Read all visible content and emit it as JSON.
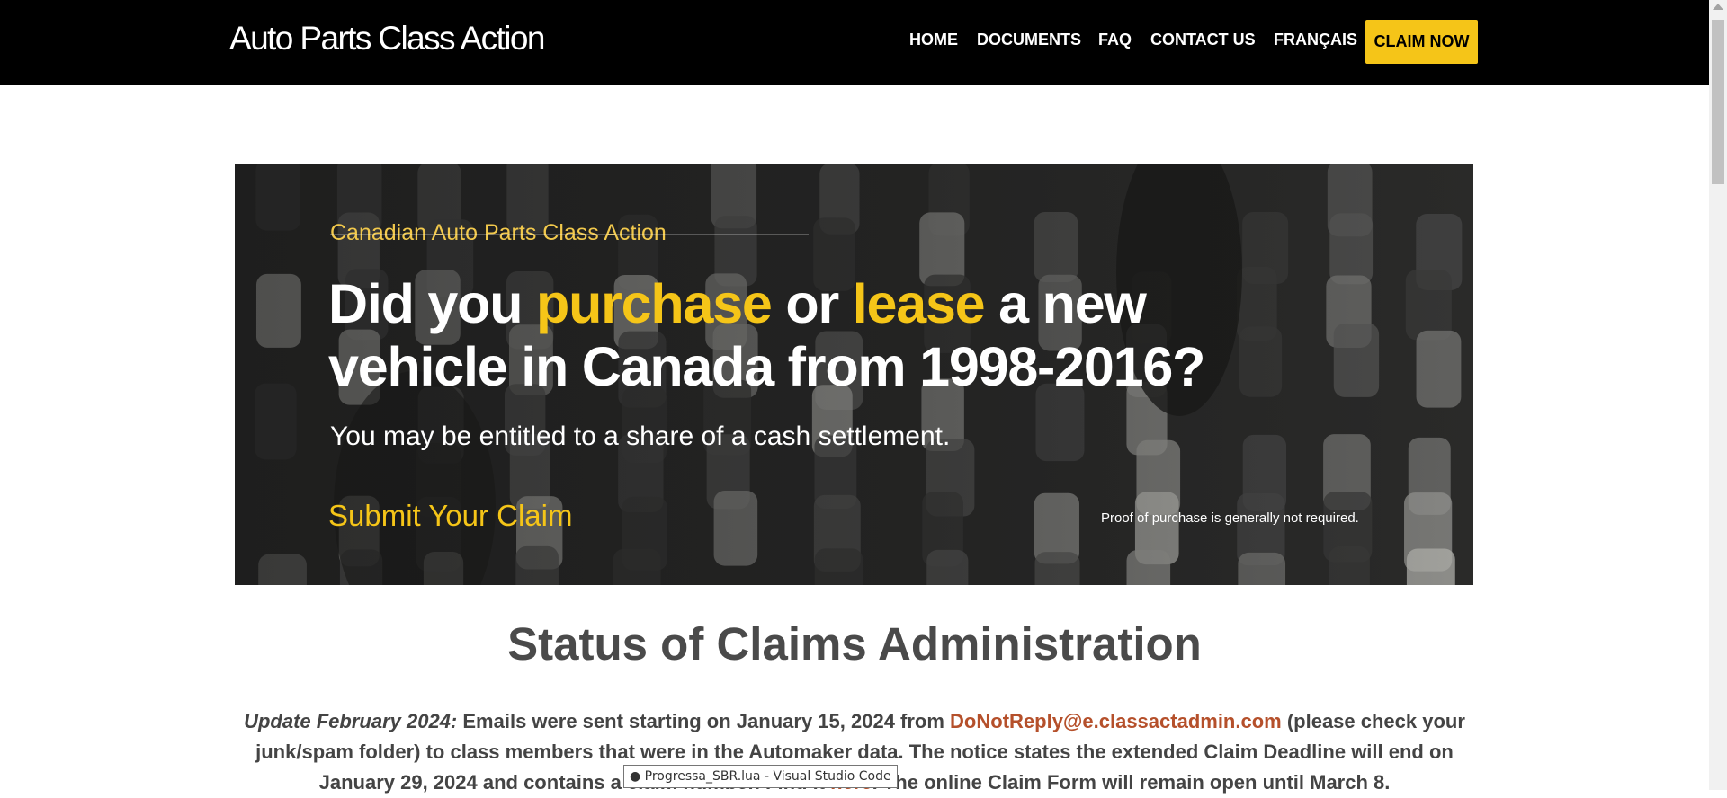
{
  "header": {
    "site_title": "Auto Parts Class Action",
    "nav": [
      "HOME",
      "DOCUMENTS",
      "FAQ",
      "CONTACT US",
      "FRANÇAIS"
    ],
    "claim_button": "CLAIM NOW"
  },
  "banner": {
    "subtitle": "Canadian Auto Parts Class Action",
    "headline": {
      "part1": "Did you ",
      "highlight1": "purchase",
      "part2": " or ",
      "highlight2": "lease",
      "part3": " a new",
      "line2": "vehicle in Canada from 1998-2016?"
    },
    "subtext": "You may be entitled to a share of a cash settlement.",
    "submit_link": "Submit Your Claim",
    "proof_note": "Proof of purchase is generally not required."
  },
  "main": {
    "title": "Status of Claims Administration",
    "paragraph": {
      "lead": "Update February 2024:",
      "text1": " Emails were sent starting on January 15, 2024 from ",
      "email": "DoNotReply@e.classactadmin.com",
      "text2": " (please check your junk/spam folder) to class members that were in the Automaker data. The notice states the extended Claim Deadline will end on January 29, 2024 and contains a claim number. Find it ",
      "here_link": "here",
      "text3": ". The online Claim Form will remain open until March 8."
    }
  },
  "tooltip": "● Progressa_SBR.lua - Visual Studio Code",
  "colors": {
    "header_bg": "#000000",
    "accent_yellow": "#f5c518",
    "link": "#b5502b",
    "body_text": "#444444"
  }
}
